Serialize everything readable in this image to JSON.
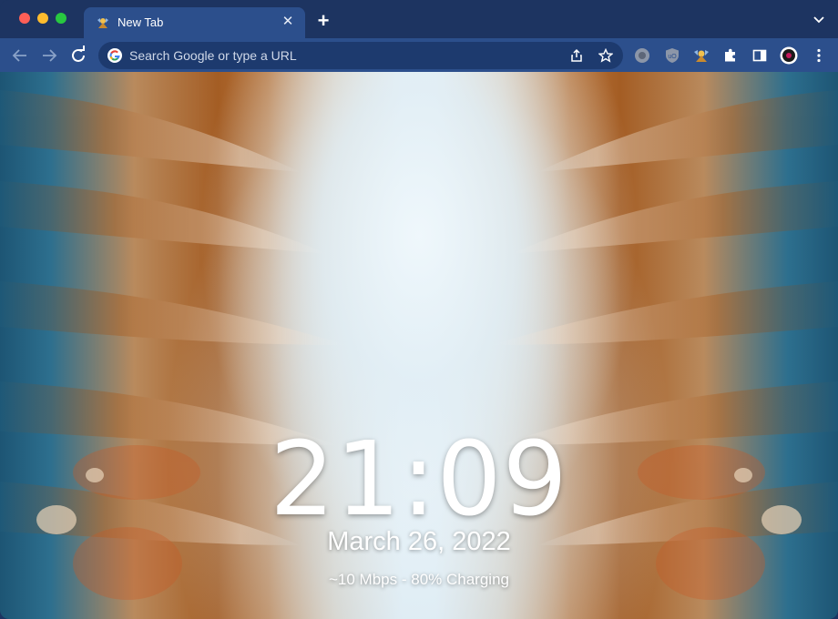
{
  "tab": {
    "title": "New Tab",
    "close_icon": "close-icon"
  },
  "toolbar": {
    "omnibox_placeholder": "Search Google or type a URL"
  },
  "newtab": {
    "clock": "21:09",
    "date": "March 26, 2022",
    "status": "~10 Mbps - 80% Charging"
  },
  "colors": {
    "frame": "#1d3461",
    "toolbar": "#2c4f8c",
    "omnibox": "#1d3a6e",
    "accent_red": "#fe5f57",
    "accent_yellow": "#febc2e",
    "accent_green": "#28c840"
  }
}
